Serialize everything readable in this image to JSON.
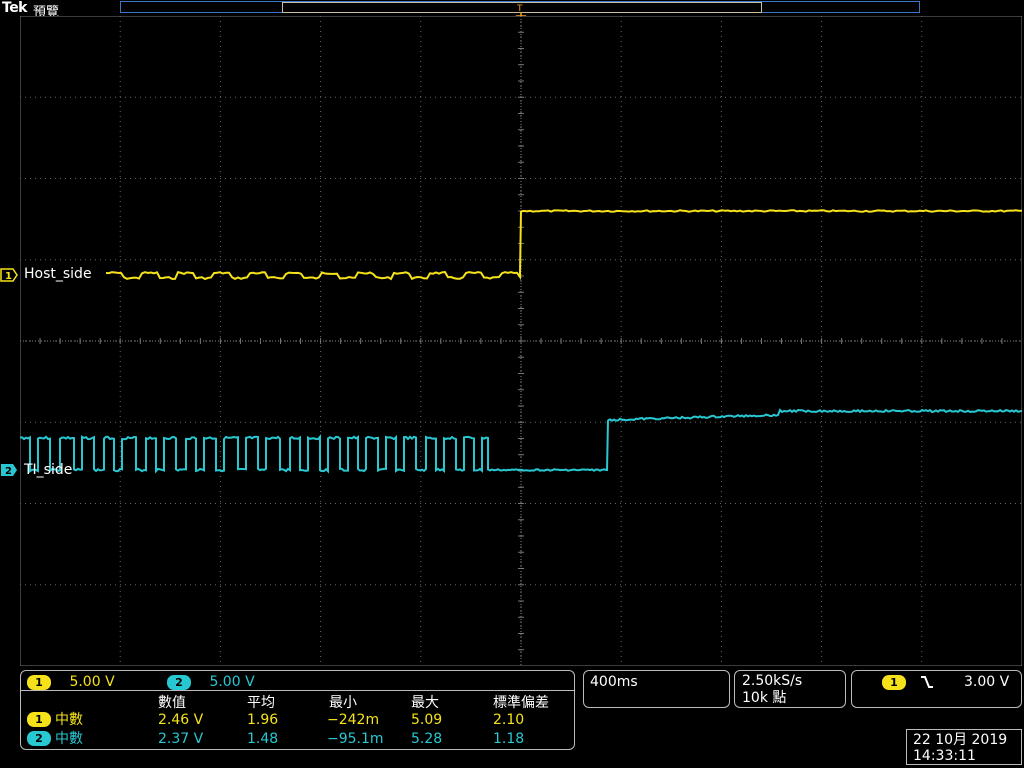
{
  "header": {
    "brand": "Tek",
    "mode": "預覽"
  },
  "channels": [
    {
      "id": "1",
      "name": "Host_side",
      "color": "#f5e21a"
    },
    {
      "id": "2",
      "name": "TI_side",
      "color": "#28c8d2"
    }
  ],
  "vertical": {
    "ch1_scale": "5.00 V",
    "ch2_scale": "5.00 V"
  },
  "measurements": {
    "headers": [
      "數值",
      "平均",
      "最小",
      "最大",
      "標準偏差"
    ],
    "rows": [
      {
        "channel": "1",
        "type": "中數",
        "value": "2.46 V",
        "mean": "1.96",
        "min": "−242m",
        "max": "5.09",
        "std": "2.10"
      },
      {
        "channel": "2",
        "type": "中數",
        "value": "2.37 V",
        "mean": "1.48",
        "min": "−95.1m",
        "max": "5.28",
        "std": "1.18"
      }
    ]
  },
  "timebase": "400ms",
  "acquisition": {
    "sample_rate": "2.50kS/s",
    "record_length": "10k 點"
  },
  "trigger": {
    "source": "1",
    "slope_icon": "falling-edge-icon",
    "level": "3.00 V"
  },
  "datetime": {
    "date": "22 10月 2019",
    "time": "14:33:11"
  }
}
